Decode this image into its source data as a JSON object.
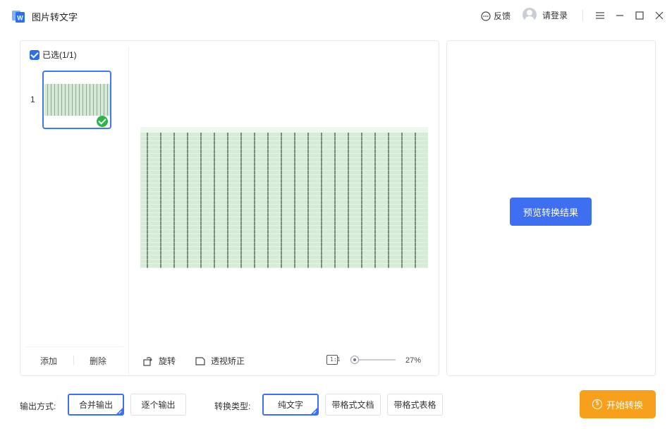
{
  "app": {
    "title": "图片转文字"
  },
  "titlebar": {
    "feedback_label": "反馈",
    "login_label": "请登录",
    "icons": [
      "app-logo",
      "feedback-icon",
      "avatar",
      "menu-icon",
      "minimize-icon",
      "maximize-icon",
      "close-icon"
    ]
  },
  "file_list": {
    "select_all_label": "已选(1/1)",
    "items": [
      {
        "index": "1",
        "selected": true
      }
    ],
    "add_label": "添加",
    "delete_label": "删除"
  },
  "preview_toolbar": {
    "rotate_label": "旋转",
    "perspective_label": "透视矫正",
    "fit_icon_text": "1:1",
    "zoom_value": "27%",
    "zoom_level": 0.27
  },
  "result_panel": {
    "preview_button_label": "预览转换结果"
  },
  "output": {
    "label": "输出方式:",
    "options": [
      "合并输出",
      "逐个输出"
    ],
    "selected": "合并输出"
  },
  "conversion": {
    "label": "转换类型:",
    "options": [
      "纯文字",
      "带格式文档",
      "带格式表格"
    ],
    "selected": "纯文字"
  },
  "start_button_label": "开始转换",
  "colors": {
    "accent": "#3d6ff0",
    "start": "#f7a01e",
    "success": "#2fb24a"
  }
}
